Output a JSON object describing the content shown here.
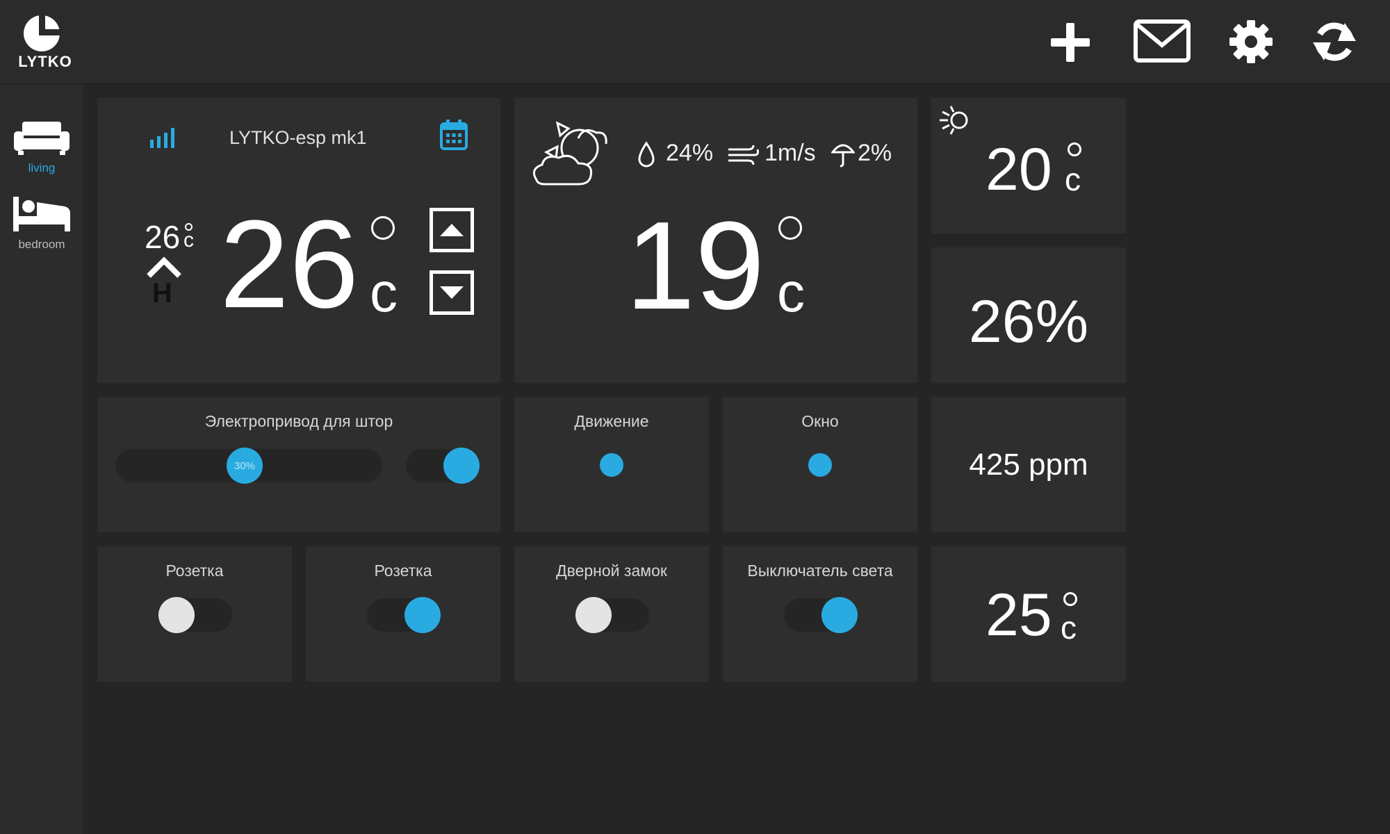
{
  "app": {
    "logo_text": "LYTKO",
    "toolbar": [
      {
        "name": "add-icon"
      },
      {
        "name": "mail-icon"
      },
      {
        "name": "settings-gear-icon"
      },
      {
        "name": "refresh-icon"
      }
    ]
  },
  "sidebar": {
    "rooms": [
      {
        "label": "living",
        "icon": "sofa-icon",
        "active": true
      },
      {
        "label": "bedroom",
        "icon": "bed-icon",
        "active": false
      }
    ]
  },
  "thermostat": {
    "device_name": "LYTKO-esp mk1",
    "set_temp": "26",
    "set_unit": "c",
    "current_temp": "26",
    "current_unit": "c",
    "mode": "H",
    "signal_icon": "signal-bars-icon",
    "schedule_icon": "calendar-icon"
  },
  "weather": {
    "humidity": "24%",
    "wind": "1m/s",
    "precipitation": "2%",
    "temp": "19",
    "unit": "c",
    "icon": "partly-cloudy-icon"
  },
  "sensors": {
    "outdoor_temp": "20",
    "outdoor_unit": "c",
    "humidity": "26%",
    "co2": "425 ppm",
    "temp2": "25",
    "temp2_unit": "c"
  },
  "curtain": {
    "title": "Электропривод для штор",
    "position_label": "30%",
    "position_fraction": 0.3,
    "toggle_on": true
  },
  "motion": {
    "title": "Движение"
  },
  "window": {
    "title": "Окно"
  },
  "switches": [
    {
      "title": "Розетка",
      "on": false
    },
    {
      "title": "Розетка",
      "on": true
    },
    {
      "title": "Дверной замок",
      "on": false
    },
    {
      "title": "Выключатель света",
      "on": true
    }
  ],
  "colors": {
    "accent": "#29abe2",
    "tile": "#2e2e2e",
    "background": "#252525"
  }
}
